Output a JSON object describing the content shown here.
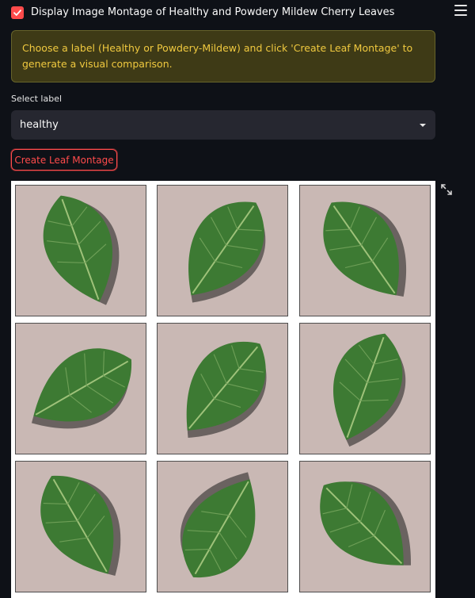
{
  "header": {
    "checkbox_label": "Display Image Montage of Healthy and Powdery Mildew Cherry Leaves",
    "checkbox_checked": true,
    "menu_icon": "hamburger-menu-icon"
  },
  "info": {
    "text": "Choose a label (Healthy or Powdery-Mildew) and click 'Create Leaf Montage' to generate a visual comparison."
  },
  "select": {
    "label": "Select label",
    "value": "healthy"
  },
  "button": {
    "label": "Create Leaf Montage"
  },
  "montage": {
    "expand_icon": "fullscreen-expand-icon",
    "tiles": [
      "leaf-image",
      "leaf-image",
      "leaf-image",
      "leaf-image",
      "leaf-image",
      "leaf-image",
      "leaf-image",
      "leaf-image",
      "leaf-image"
    ]
  },
  "colors": {
    "background": "#0e1117",
    "accent": "#ff4b4b",
    "alert_bg": "#3e3a16",
    "alert_text": "#f0c93f",
    "leaf": "#3d7a33",
    "leaf_bg": "#c9b8b4"
  }
}
